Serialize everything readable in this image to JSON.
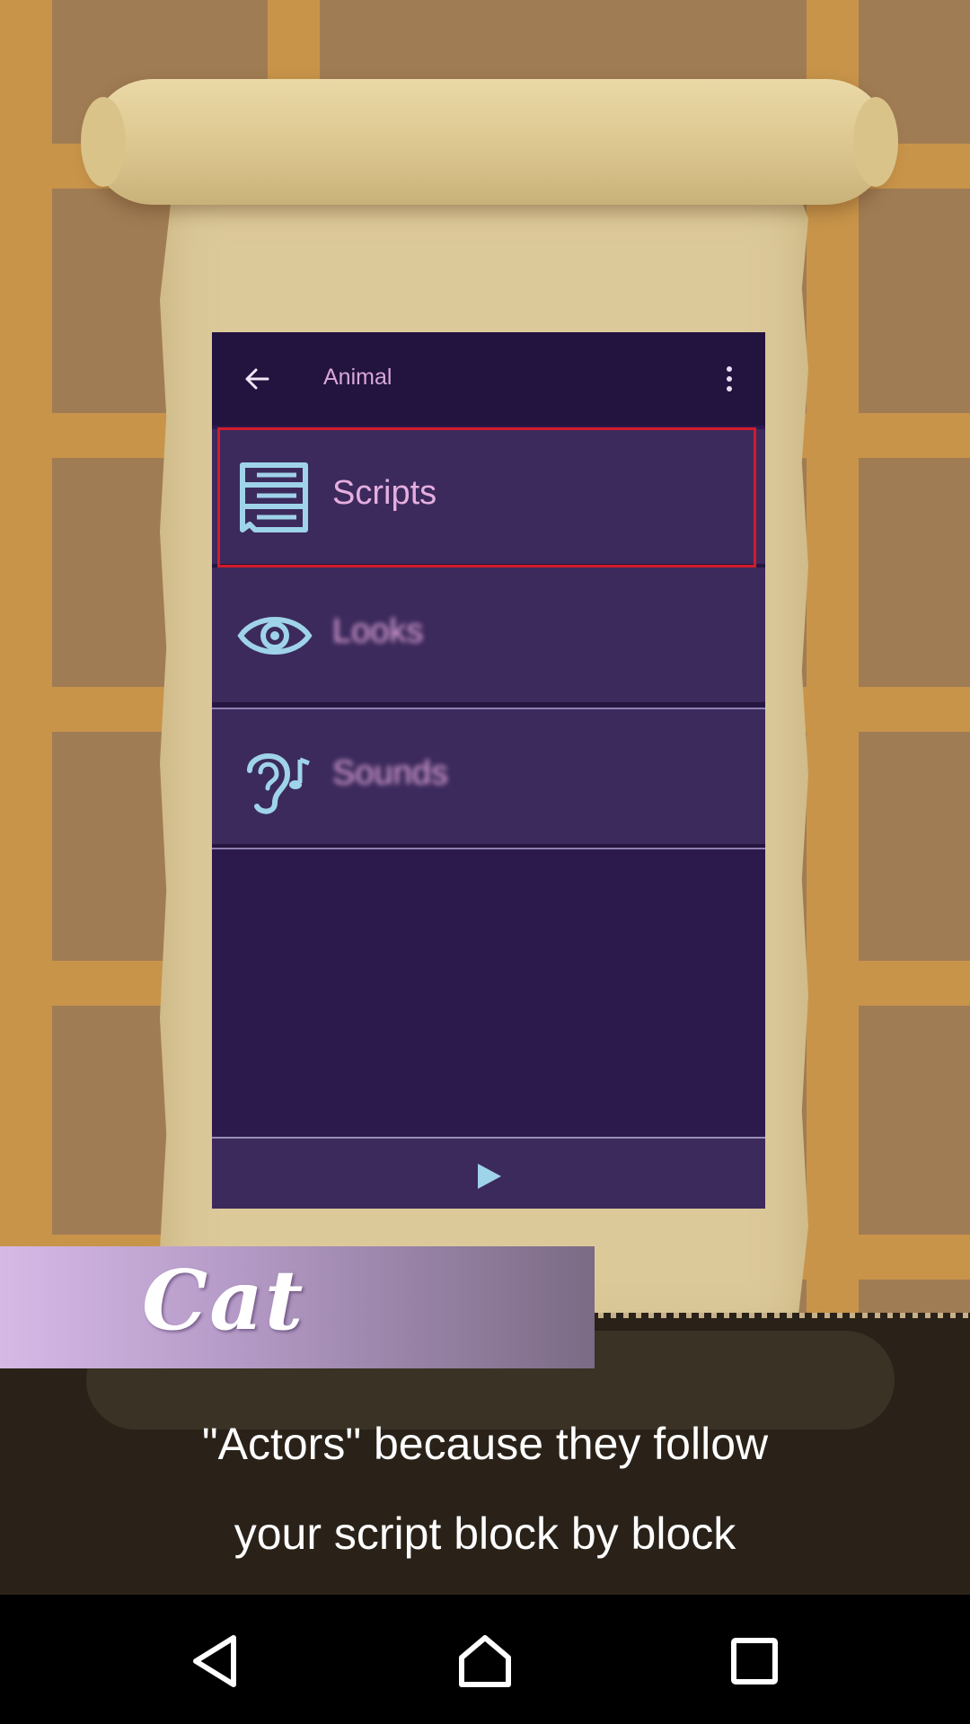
{
  "app": {
    "title": "Animal",
    "menu_items": [
      {
        "label": "Scripts",
        "icon": "scripts-list-icon",
        "highlighted": true
      },
      {
        "label": "Looks",
        "icon": "eye-icon",
        "blurred": true
      },
      {
        "label": "Sounds",
        "icon": "ear-music-icon",
        "blurred": true
      }
    ],
    "play_icon": "play-icon"
  },
  "banner": {
    "name": "Cat"
  },
  "caption": {
    "line1": "\"Actors\" because they follow",
    "line2": "your script block by block"
  },
  "colors": {
    "accent_icon": "#9fd3ea",
    "label_pink": "#e6aee0",
    "highlight_red": "#d21b2b",
    "app_bg": "#2c1a4c"
  },
  "navbar": {
    "buttons": [
      "back-icon",
      "home-icon",
      "recents-icon"
    ]
  }
}
